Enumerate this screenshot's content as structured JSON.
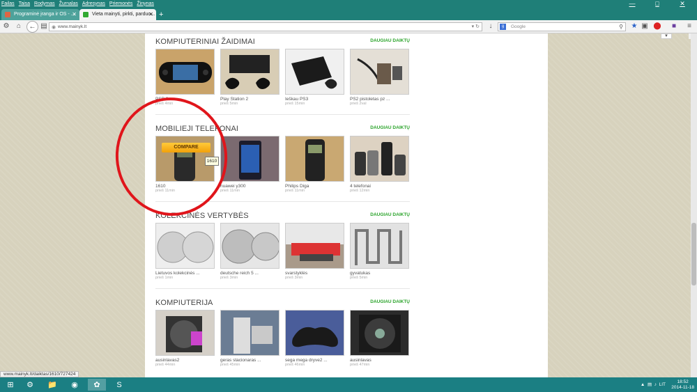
{
  "browser": {
    "menu": [
      "Failas",
      "Taisa",
      "Rodymas",
      "Žurnalas",
      "Adresynas",
      "Priemonės",
      "Žinynas"
    ],
    "tabs": [
      {
        "label": "Programinė įranga ir OS - ..."
      },
      {
        "label": "Vieta mainyti, pirkti, parduo..."
      }
    ],
    "url": "www.mainyk.lt",
    "search_placeholder": "Google",
    "status_url": "www.mainyk.lt/daiktas/1610/727424"
  },
  "sections": [
    {
      "title": "KOMPIUTERINIAI ŽAIDIMAI",
      "more": "DAUGIAU DAIKTŲ",
      "items": [
        {
          "name": "PSP 2",
          "time": "prieš 4min"
        },
        {
          "name": "Play Station 2",
          "time": "prieš 5min"
        },
        {
          "name": "Ieškau PS3",
          "time": "prieš 15min"
        },
        {
          "name": "PS2 pistoletas pz ...",
          "time": "prieš 2val"
        }
      ]
    },
    {
      "title": "MOBILIEJI TELEFONAI",
      "more": "DAUGIAU DAIKTŲ",
      "items": [
        {
          "name": "1610",
          "time": "prieš 11min"
        },
        {
          "name": "huawei y300",
          "time": "prieš 11min"
        },
        {
          "name": "Philips Diga",
          "time": "prieš 11min"
        },
        {
          "name": "4 telefonai",
          "time": "prieš 12min"
        }
      ]
    },
    {
      "title": "KOLEKCINĖS VERTYBĖS",
      "more": "DAUGIAU DAIKTŲ",
      "items": [
        {
          "name": "Lietuvos kolekcinės ...",
          "time": "prieš 1min"
        },
        {
          "name": "deutsche reich 5 ...",
          "time": "prieš 3min"
        },
        {
          "name": "svarstyklės",
          "time": "prieš 3min"
        },
        {
          "name": "gyvatukas",
          "time": "prieš 5min"
        }
      ]
    },
    {
      "title": "KOMPIUTERIJA",
      "more": "DAUGIAU DAIKTŲ",
      "items": [
        {
          "name": "ausinlavas2",
          "time": "prieš 44min"
        },
        {
          "name": "geras stacionaras ...",
          "time": "prieš 45min"
        },
        {
          "name": "sega mega dryve2 ...",
          "time": "prieš 46min"
        },
        {
          "name": "ausinlavas",
          "time": "prieš 47min"
        }
      ]
    }
  ],
  "overlay": {
    "compare_label": "COMPARE",
    "tooltip": "1610"
  },
  "taskbar": {
    "lang": "LIT",
    "time": "18:52",
    "date": "2014-11-18"
  }
}
